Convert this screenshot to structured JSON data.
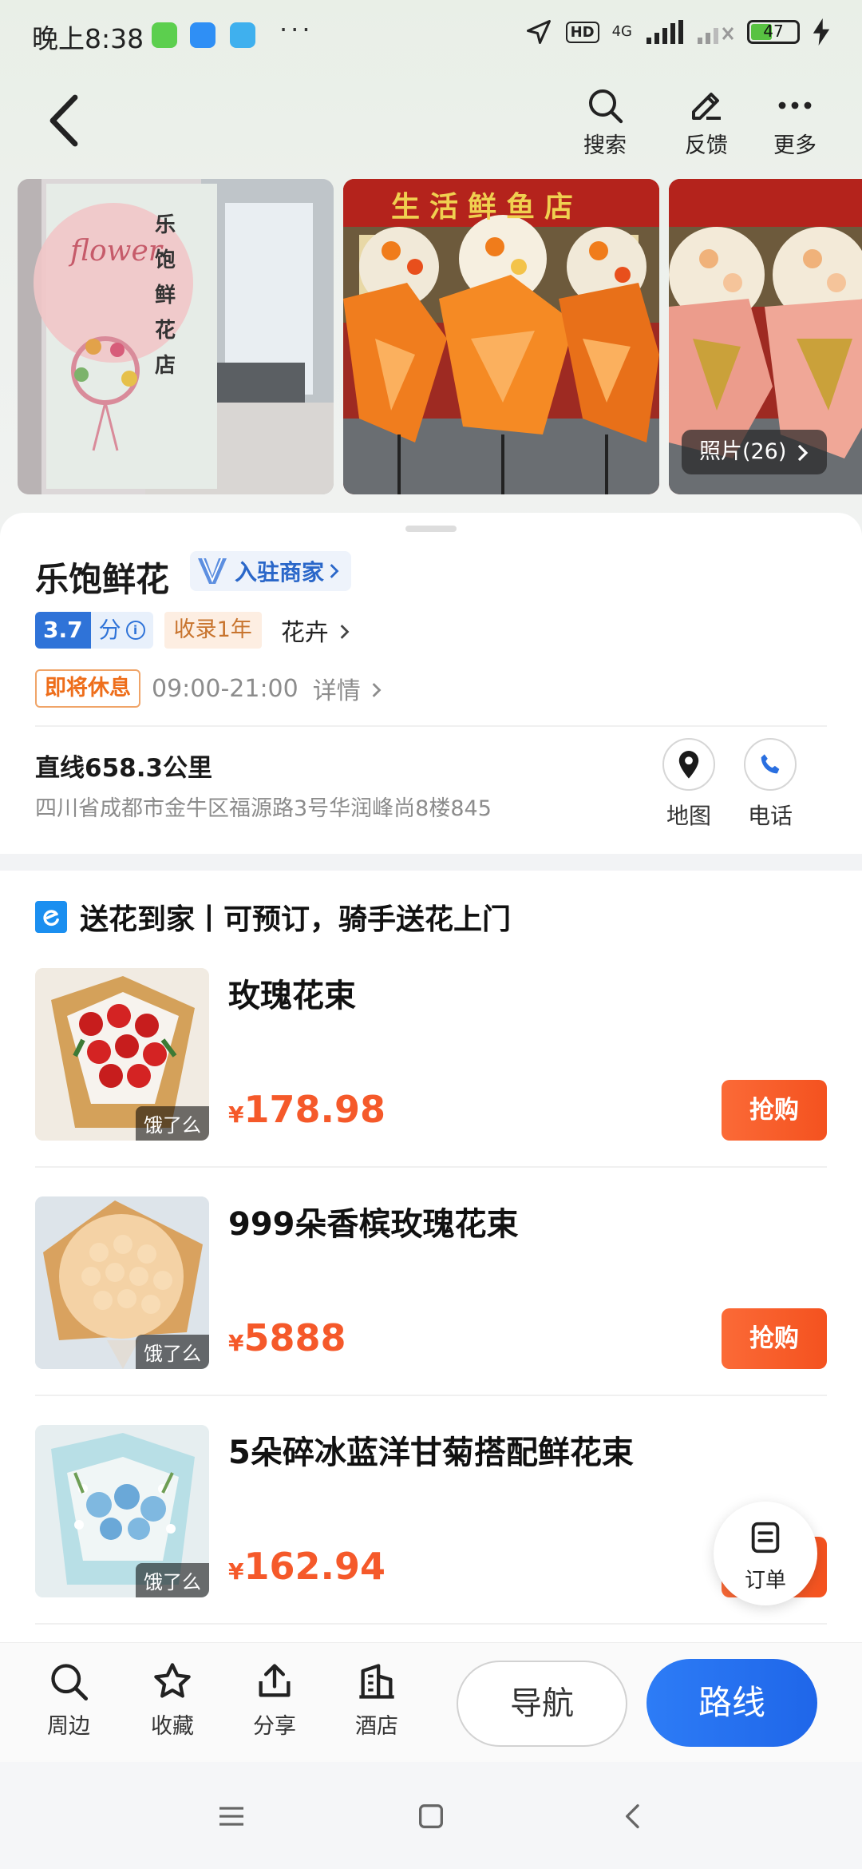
{
  "status_bar": {
    "time": "晚上8:38",
    "more": "···",
    "hd": "HD",
    "network": "4G",
    "battery": "47",
    "battery_level": 0.47
  },
  "header": {
    "actions": [
      {
        "label": "搜索",
        "icon": "search-icon"
      },
      {
        "label": "反馈",
        "icon": "pencil-icon"
      },
      {
        "label": "更多",
        "icon": "more-dots-icon"
      }
    ]
  },
  "photos": {
    "count_label": "照片(26)",
    "sign_text": "乐饱鲜花店",
    "sign_script": "flower",
    "banner_text": "生活鲜鱼店"
  },
  "shop": {
    "name": "乐饱鲜花",
    "merchant_badge": "入驻商家",
    "rating_score": "3.7",
    "rating_unit": "分",
    "years_tag": "收录1年",
    "category": "花卉",
    "status_tag": "即将休息",
    "hours": "09:00-21:00",
    "detail_link": "详情",
    "distance": "直线658.3公里",
    "address": "四川省成都市金牛区福源路3号华润峰尚8楼845",
    "map_label": "地图",
    "phone_label": "电话"
  },
  "delivery": {
    "title": "送花到家丨可预订，骑手送花上门",
    "products": [
      {
        "name": "玫瑰花束",
        "currency": "¥",
        "price": "178.98",
        "tag": "饿了么",
        "buy_label": "抢购"
      },
      {
        "name": "999朵香槟玫瑰花束",
        "currency": "¥",
        "price": "5888",
        "tag": "饿了么",
        "buy_label": "抢购"
      },
      {
        "name": "5朵碎冰蓝洋甘菊搭配鲜花束",
        "currency": "¥",
        "price": "162.94",
        "tag": "饿了么",
        "buy_label": "抢购"
      }
    ]
  },
  "fab": {
    "label": "订单"
  },
  "bottom_bar": {
    "items": [
      {
        "label": "周边",
        "icon": "search-icon"
      },
      {
        "label": "收藏",
        "icon": "star-icon"
      },
      {
        "label": "分享",
        "icon": "share-icon"
      },
      {
        "label": "酒店",
        "icon": "hotel-icon"
      }
    ],
    "nav_label": "导航",
    "route_label": "路线"
  },
  "colors": {
    "accent_blue": "#2d7cf6",
    "price_orange": "#f5592a",
    "buy_button": "#f4521f",
    "rating_blue": "#2f73d8"
  }
}
